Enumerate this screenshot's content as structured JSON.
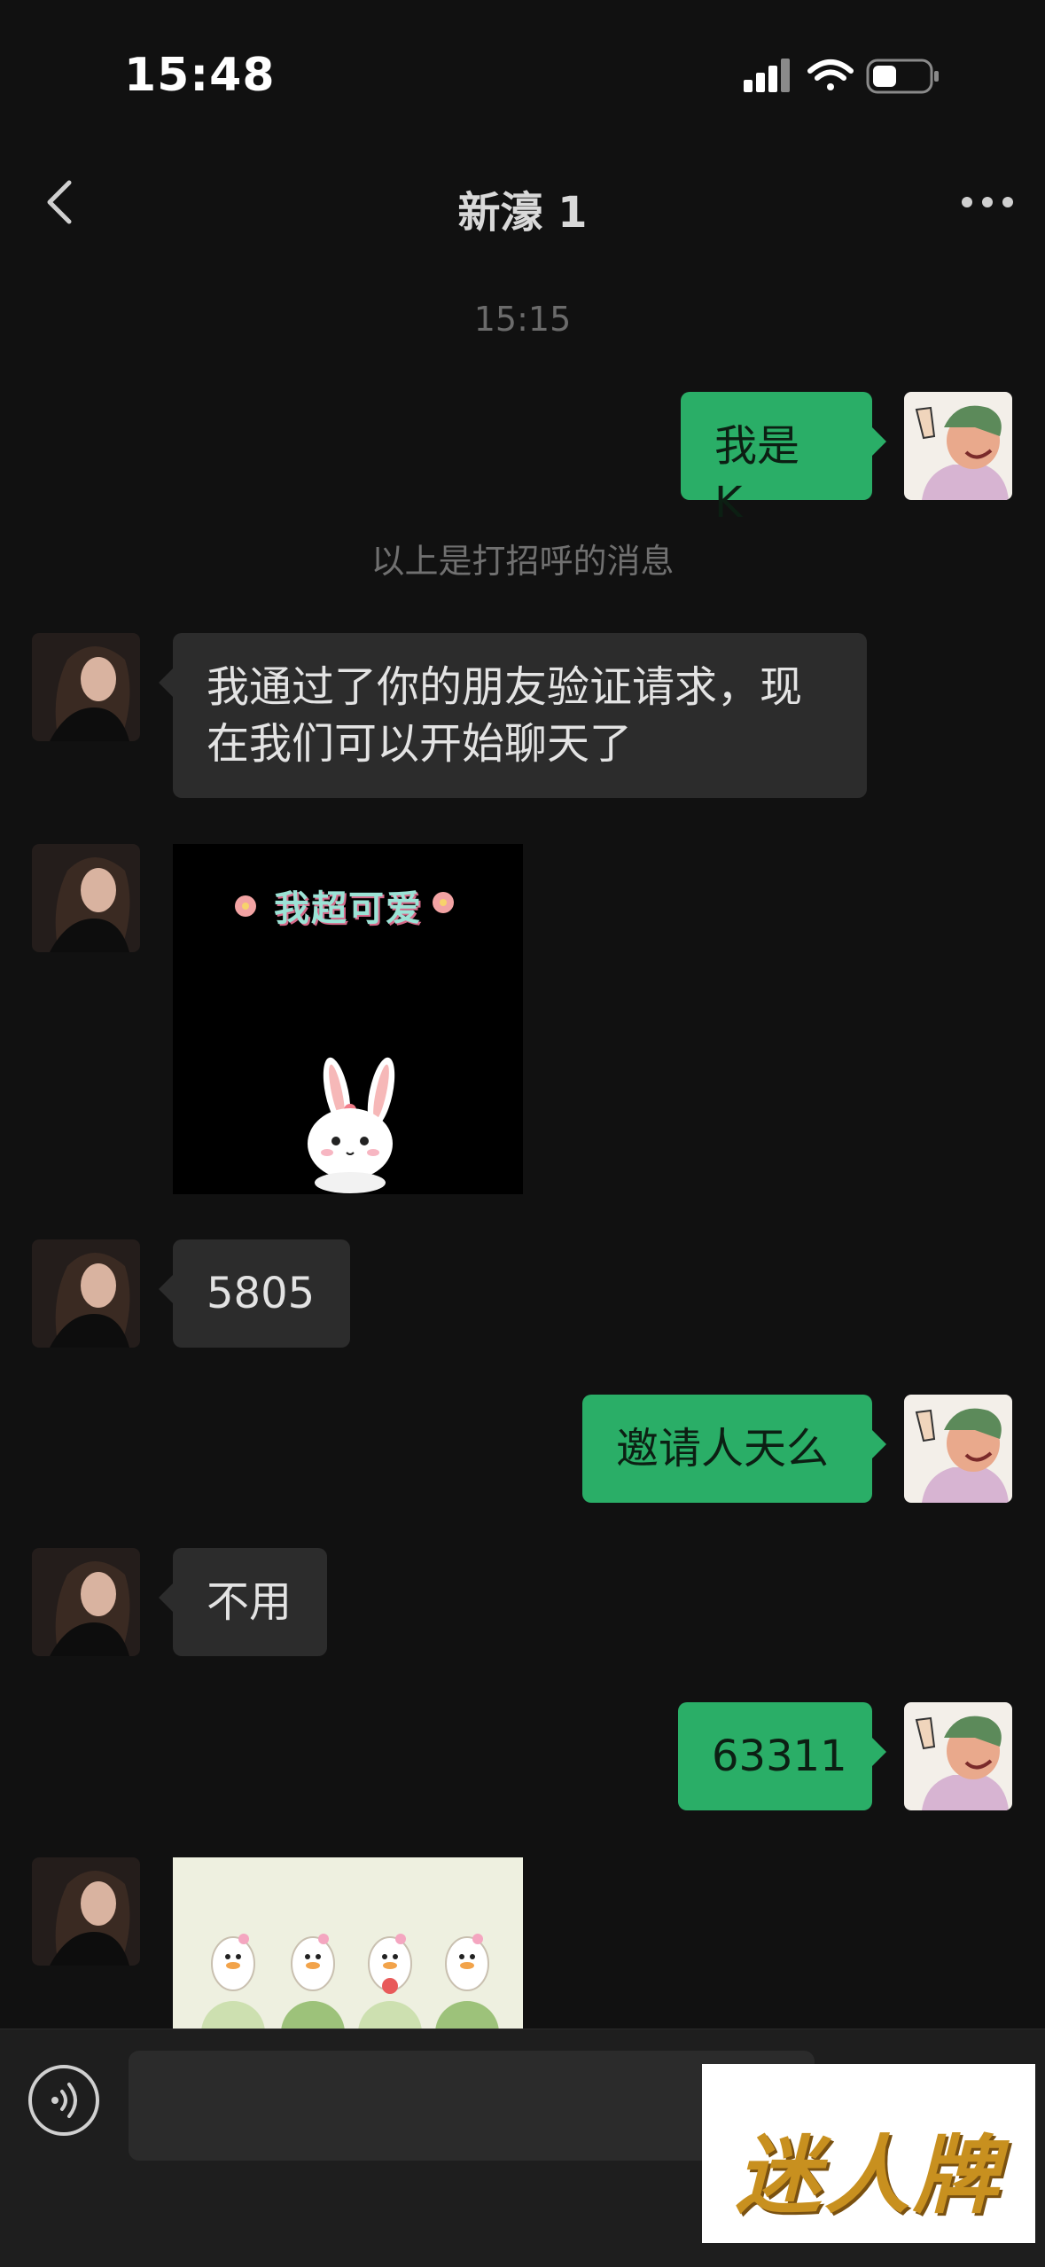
{
  "status_bar": {
    "time": "15:48",
    "icons": [
      "cellular-signal-icon",
      "wifi-icon",
      "battery-icon"
    ]
  },
  "header": {
    "title": "新濠 1",
    "back_icon": "chevron-left-icon",
    "more_icon": "more-dots-icon"
  },
  "chat": {
    "timestamp": "15:15",
    "system_notice": "以上是打招呼的消息",
    "messages": [
      {
        "direction": "out",
        "type": "text",
        "text": "我是 K"
      },
      {
        "direction": "in",
        "type": "text",
        "text_line1": "我通过了你的朋友验证请求，现",
        "text_line2": "在我们可以开始聊天了"
      },
      {
        "direction": "in",
        "type": "sticker",
        "caption": "我超可爱"
      },
      {
        "direction": "in",
        "type": "text",
        "text": "5805"
      },
      {
        "direction": "out",
        "type": "text",
        "text": "邀请人天么"
      },
      {
        "direction": "in",
        "type": "text",
        "text": "不用"
      },
      {
        "direction": "out",
        "type": "text",
        "text": "63311"
      },
      {
        "direction": "in",
        "type": "sticker",
        "caption": ""
      }
    ]
  },
  "input_bar": {
    "voice_icon": "voice-input-icon",
    "placeholder": ""
  },
  "watermark": {
    "text": "迷人牌"
  },
  "colors": {
    "background": "#111111",
    "outgoing_bubble": "#2aae67",
    "incoming_bubble": "#2c2c2c"
  }
}
